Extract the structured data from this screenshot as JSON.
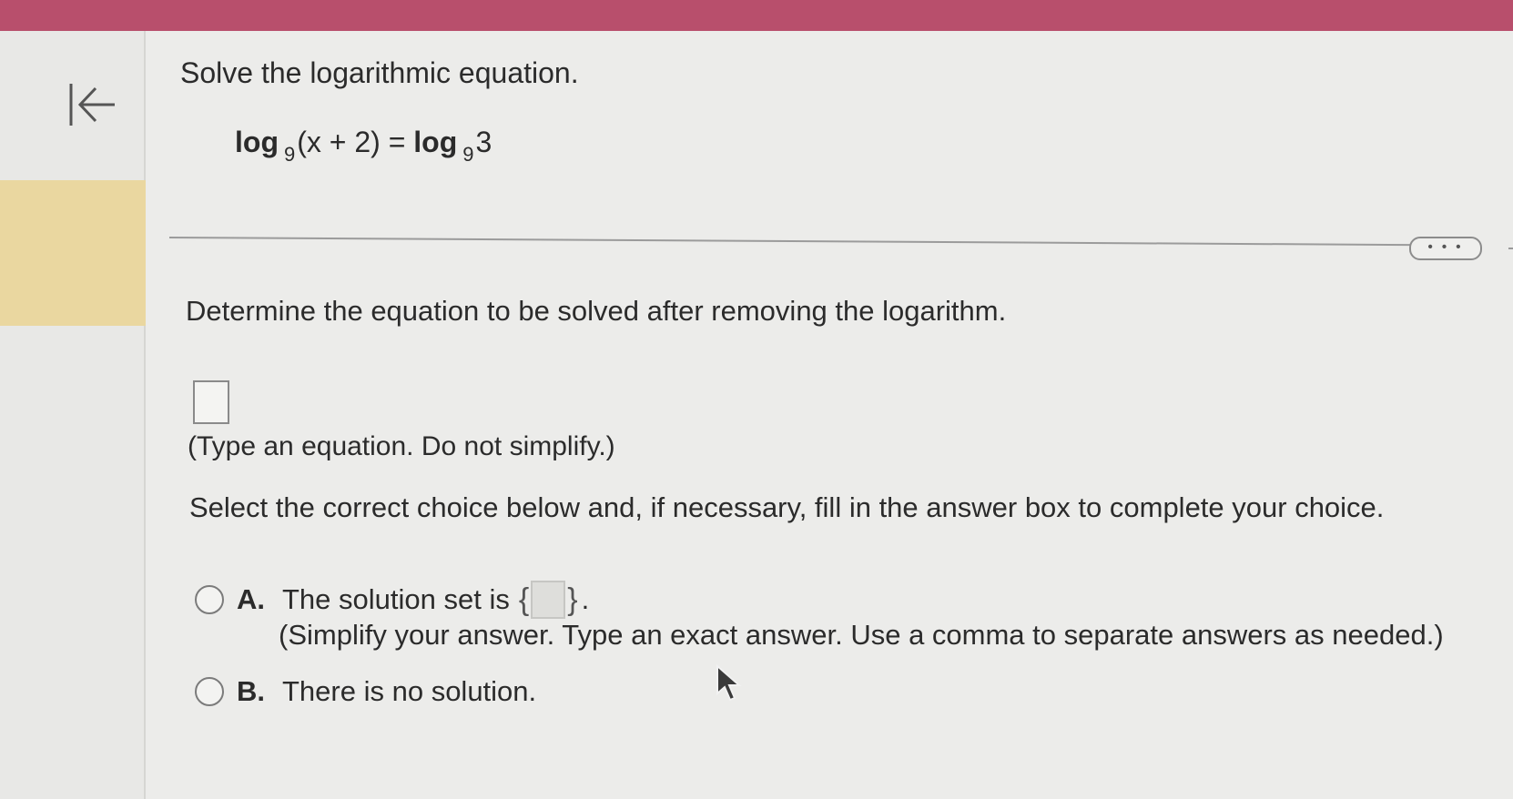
{
  "header": {
    "accent_color": "#b84f6c"
  },
  "nav": {
    "back_icon": "collapse-left-icon",
    "highlight_color": "#ead7a0"
  },
  "problem": {
    "title": "Solve the logarithmic equation.",
    "equation": {
      "log_left": "log",
      "base_left": "9",
      "argument_left": "(x + 2) = ",
      "log_right": "log",
      "base_right": "9",
      "argument_right": "3"
    }
  },
  "toolbar": {
    "more_label": "• • •"
  },
  "step1": {
    "instruction": "Determine the equation to be solved after removing the logarithm.",
    "answer_value": "",
    "hint": "(Type an equation. Do not simplify.)"
  },
  "step2": {
    "prompt": "Select the correct choice below and, if necessary, fill in the answer box to complete your choice.",
    "choices": [
      {
        "letter": "A.",
        "text": "The solution set is",
        "open_brace": "{",
        "close_brace": "}",
        "suffix": ".",
        "answer_value": "",
        "hint": "(Simplify your answer. Type an exact answer. Use a comma to separate answers as needed.)"
      },
      {
        "letter": "B.",
        "text": "There is no solution."
      }
    ]
  }
}
